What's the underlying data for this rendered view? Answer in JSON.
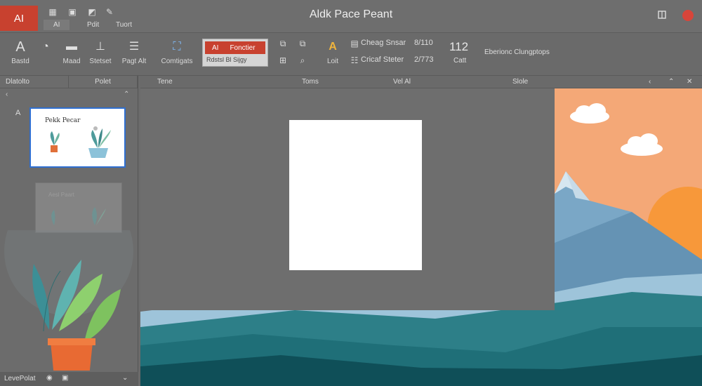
{
  "titlebar": {
    "app_badge": "AI",
    "title": "Aldk Pace Peant",
    "tabs": [
      "AI",
      "Pdit",
      "Tuort"
    ],
    "icons": [
      "grid-icon",
      "photo-icon",
      "image-icon",
      "pen-icon"
    ]
  },
  "ribbon": {
    "buttons": [
      {
        "icon": "text-A-icon",
        "label": "Bastd"
      },
      {
        "icon": "shape-icon",
        "label": ""
      },
      {
        "icon": "slide-icon",
        "label": "Maad"
      },
      {
        "icon": "pin-icon",
        "label": "Stetset"
      },
      {
        "icon": "layout-icon",
        "label": "Pagt Alt"
      },
      {
        "icon": "image-edit-icon",
        "label": "Comtigats"
      }
    ],
    "font_box": {
      "left": "AI",
      "right": "Fonctier",
      "sub": "Rdstsl Bl Sijgy"
    },
    "text_a_label": "Loit",
    "rows": [
      "Cheag Snsar",
      "Cricaf Steter"
    ],
    "row_values": [
      "8/110",
      "2/773"
    ],
    "big_number": "112",
    "big_number_label": "Catt",
    "right_label": "Eberionc Clungptops"
  },
  "left_panel": {
    "tabs": [
      "Dlatolto",
      "Polet"
    ],
    "slide_number": "A",
    "thumb_title": "Pekk Pecar",
    "thumb2_title": "Aesl Paart",
    "status": "LevePolat"
  },
  "column_heads": [
    "Tene",
    "Toms",
    "Vel Al",
    "Slole"
  ],
  "colors": {
    "accent_red": "#c8412f",
    "sky": "#f4a877",
    "sun": "#f7983a",
    "mountain_light": "#7aa7c6",
    "hill_teal": "#1f6f78",
    "hill_dark": "#0f4f58"
  }
}
